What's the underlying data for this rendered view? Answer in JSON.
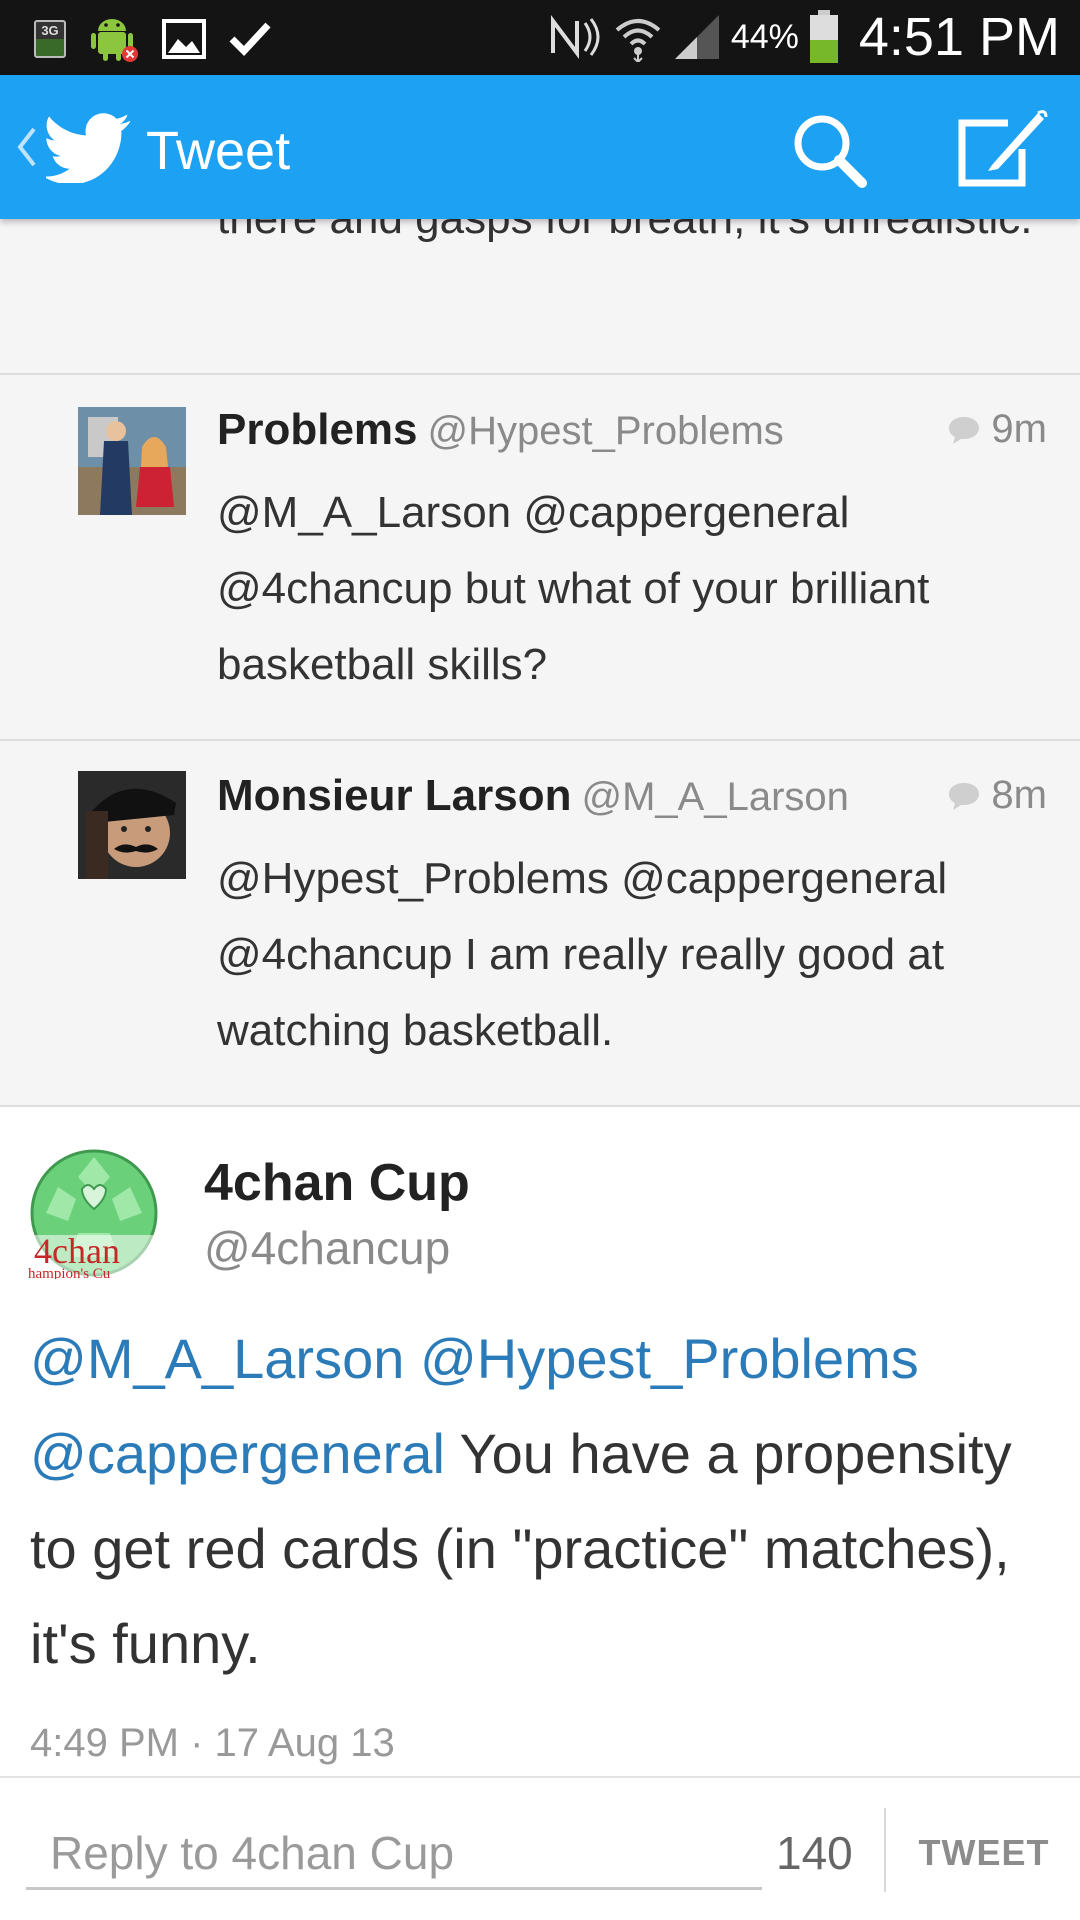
{
  "status_bar": {
    "network_badge": "3G",
    "battery_percent": "44%",
    "time": "4:51 PM",
    "icons": [
      "3g-icon",
      "android-debug-icon",
      "image-icon",
      "check-icon",
      "nfc-icon",
      "wifi-icon",
      "signal-icon",
      "battery-icon"
    ]
  },
  "app_bar": {
    "title": "Tweet",
    "icons": [
      "back-chevron-icon",
      "twitter-bird-icon",
      "search-icon",
      "compose-icon"
    ],
    "accent_color": "#1da1f2"
  },
  "conversation": {
    "previous_text_tail": "there and gasps for breath, it's unrealistic.",
    "replies": [
      {
        "name": "Problems",
        "handle": "@Hypest_Problems",
        "time": "9m",
        "text": "@M_A_Larson @cappergeneral @4chancup but what of your brilliant basketball skills?"
      },
      {
        "name": "Monsieur Larson",
        "handle": "@M_A_Larson",
        "time": "8m",
        "text": "@Hypest_Problems @cappergeneral @4chancup I am really really good at watching basketball."
      }
    ]
  },
  "main_tweet": {
    "name": "4chan Cup",
    "handle": "@4chancup",
    "avatar_text": "4chan",
    "avatar_subtext": "hampion's Cu",
    "mentions": [
      "@M_A_Larson",
      "@Hypest_Problems",
      "@cappergeneral"
    ],
    "text": "You have a propensity to get red cards (in \"practice\" matches), it's funny.",
    "timestamp": "4:49 PM · 17 Aug 13",
    "link_color": "#2b7bb9"
  },
  "reply_bar": {
    "placeholder": "Reply to 4chan Cup",
    "value": "",
    "char_count": "140",
    "tweet_label": "TWEET"
  }
}
